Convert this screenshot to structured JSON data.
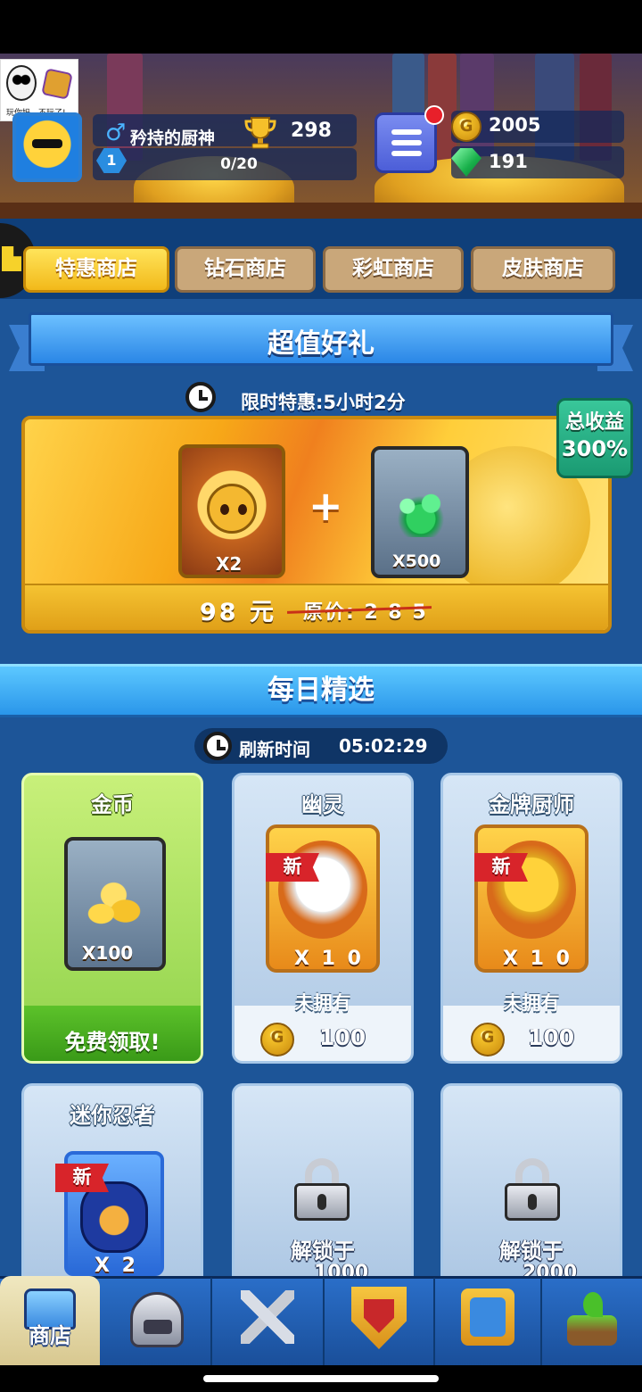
{
  "watermark": {
    "text": "玩你妈，不玩了!"
  },
  "player": {
    "name": "矜持的厨神",
    "level": "1",
    "xp": "0/20",
    "trophies": "298"
  },
  "resources": {
    "coins": "2005",
    "gems": "191"
  },
  "tabs": [
    {
      "label": "特惠商店",
      "active": true
    },
    {
      "label": "钻石商店",
      "active": false
    },
    {
      "label": "彩虹商店",
      "active": false
    },
    {
      "label": "皮肤商店",
      "active": false
    }
  ],
  "offer": {
    "section_title": "超值好礼",
    "timer": "限时特惠:5小时2分",
    "hero_qty": "X2",
    "plus": "+",
    "gem_qty": "X500",
    "price": "98 元",
    "original_price": "原价: 2 8 5",
    "badge_line1": "总收益",
    "badge_line2": "300%"
  },
  "daily": {
    "title": "每日精选",
    "refresh_label": "刷新时间",
    "refresh_time": "05:02:29",
    "items": [
      {
        "title": "金币",
        "qty": "X100",
        "action": "免费领取!"
      },
      {
        "title": "幽灵",
        "tag": "新",
        "qty": "X 1 0",
        "status": "未拥有",
        "price": "100"
      },
      {
        "title": "金牌厨师",
        "tag": "新",
        "qty": "X 1 0",
        "status": "未拥有",
        "price": "100"
      },
      {
        "title": "迷你忍者",
        "tag": "新",
        "qty": "X 2"
      },
      {
        "unlock": "解锁于",
        "unlock_value": "1000"
      },
      {
        "unlock": "解锁于",
        "unlock_value": "2000"
      }
    ]
  },
  "nav": {
    "shop_label": "商店"
  },
  "icons": [
    "gender-male-icon",
    "level-badge-icon",
    "trophy-icon",
    "menu-icon",
    "coin-icon",
    "gem-icon",
    "clock-icon",
    "lock-icon",
    "chest-icon",
    "helmet-icon",
    "swords-icon",
    "shield-icon",
    "team-icon",
    "island-icon"
  ],
  "colors": {
    "tab_active": "#f2b91a",
    "tab_inactive": "#c9a77a",
    "panel": "#1d5598",
    "notification": "#e8202a",
    "gem_green": "#18b04a"
  }
}
